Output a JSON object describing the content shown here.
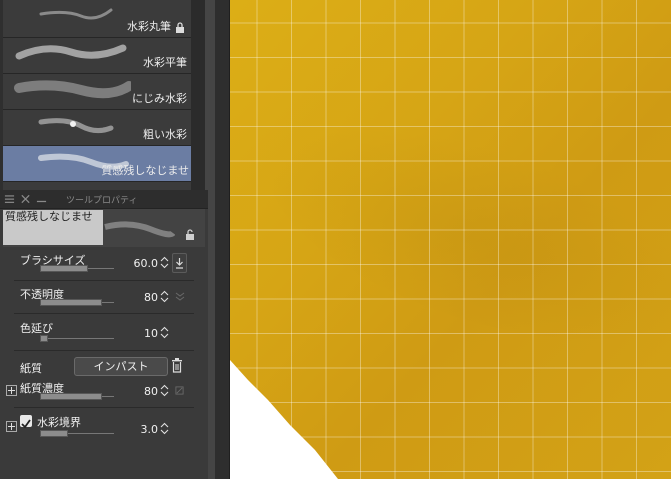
{
  "brush_list": {
    "items": [
      {
        "label": "水彩丸筆",
        "locked": true
      },
      {
        "label": "水彩平筆",
        "locked": false
      },
      {
        "label": "にじみ水彩",
        "locked": false
      },
      {
        "label": "粗い水彩",
        "locked": false
      },
      {
        "label": "質感残しなじませ",
        "locked": false,
        "selected": true
      }
    ]
  },
  "tool_property": {
    "title": "ツールプロパティ",
    "preview_label": "質感残しなじませ",
    "brush_size": {
      "label": "ブラシサイズ",
      "value": "60.0",
      "level": 0.6
    },
    "opacity": {
      "label": "不透明度",
      "value": "80",
      "level": 0.8
    },
    "color_stretch": {
      "label": "色延び",
      "value": "10",
      "level": 0.1
    },
    "paper": {
      "label": "紙質",
      "button": "インパスト"
    },
    "paper_density": {
      "label": "紙質濃度",
      "value": "80",
      "level": 0.8
    },
    "watercolor_edge": {
      "label": "水彩境界",
      "value": "3.0",
      "level": 0.45,
      "checked": true
    }
  },
  "colors": {
    "canvas_yellow": "#d8a713",
    "selection": "#6b7da3",
    "panel": "#3a3a3a"
  }
}
